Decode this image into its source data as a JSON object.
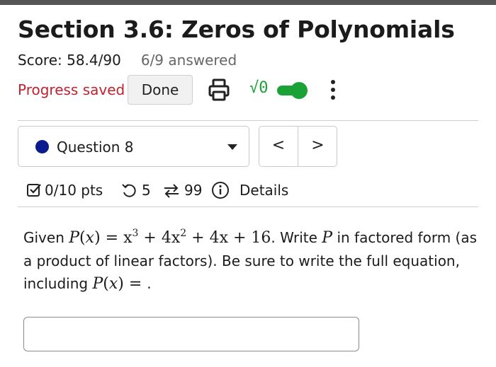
{
  "page": {
    "title": "Section 3.6: Zeros of Polynomials",
    "score": "Score: 58.4/90",
    "answered": "6/9 answered",
    "progress_status": "Progress saved",
    "done_label": "Done",
    "math_toggle_label": "√0",
    "math_toggle_on": true
  },
  "question_nav": {
    "selected": "Question 8",
    "prev_label": "<",
    "next_label": ">"
  },
  "stats": {
    "points": "0/10 pts",
    "retries": "5",
    "submissions": "99",
    "details_label": "Details"
  },
  "question": {
    "p1": "Given ",
    "m1_name": "P",
    "m1_var": "x",
    "m1_rest": " = x",
    "exp3": "3",
    "m2": " + 4x",
    "exp2": "2",
    "m3": " + 4x + 16",
    "p2": ". Write ",
    "m4": "P",
    "p3": " in factored form (as a product of linear factors). Be sure to write the full equation, including ",
    "m5_name": "P",
    "m5_var": "x",
    "m5_rest": " = ",
    "p4": "."
  },
  "answer": {
    "value": "",
    "placeholder": ""
  },
  "colors": {
    "accent_green": "#1aa236",
    "progress_red": "#c0232e",
    "question_dot": "#0b1a8c"
  },
  "icons": [
    "print-icon",
    "math-sqrt-icon",
    "kebab-menu-icon",
    "caret-down-icon",
    "checkbox-icon",
    "retry-icon",
    "submissions-icon",
    "info-icon"
  ]
}
